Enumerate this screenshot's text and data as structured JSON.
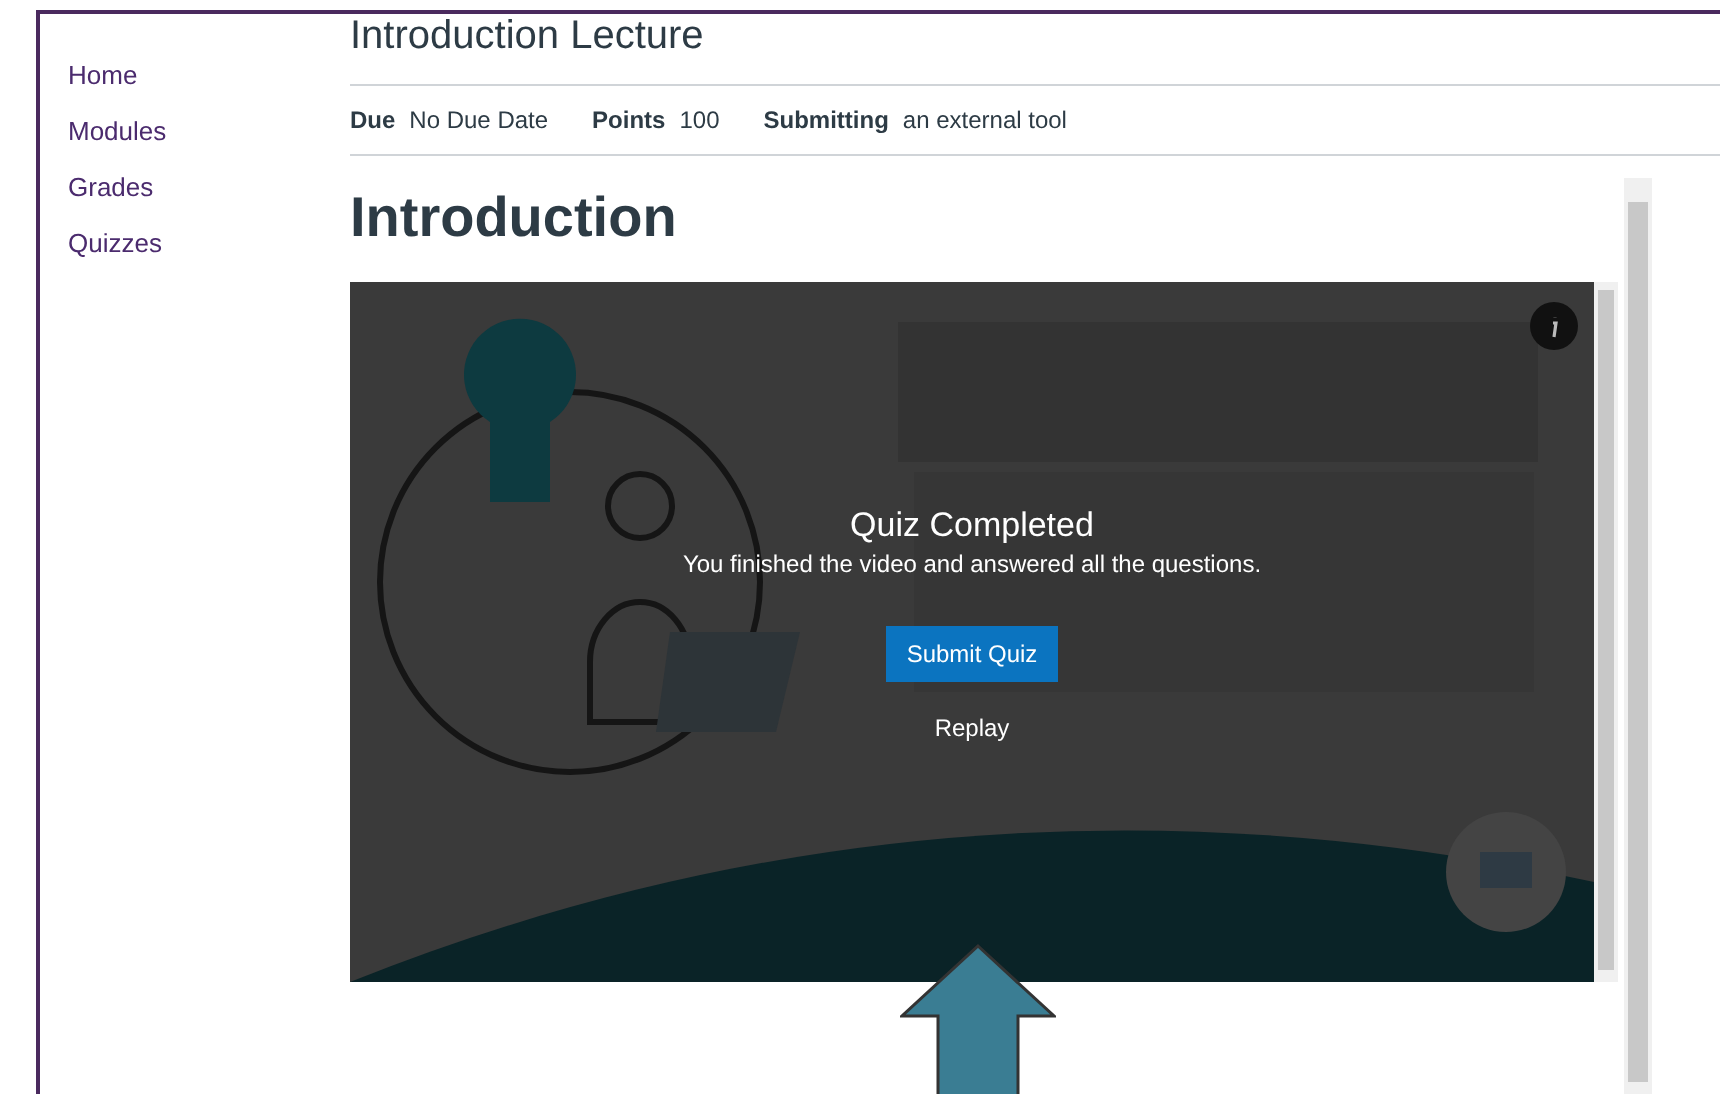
{
  "nav": {
    "items": [
      {
        "label": "Home"
      },
      {
        "label": "Modules"
      },
      {
        "label": "Grades"
      },
      {
        "label": "Quizzes"
      }
    ]
  },
  "page": {
    "title": "Introduction Lecture",
    "details": [
      {
        "label": "Due",
        "value": "No Due Date"
      },
      {
        "label": "Points",
        "value": "100"
      },
      {
        "label": "Submitting",
        "value": "an external tool"
      }
    ],
    "heading": "Introduction"
  },
  "video": {
    "kind": "picture",
    "overlay": {
      "title": "Quiz Completed",
      "message": "You finished the video and answered all the questions.",
      "submit": "Submit Quiz",
      "replay": "Replay"
    }
  }
}
